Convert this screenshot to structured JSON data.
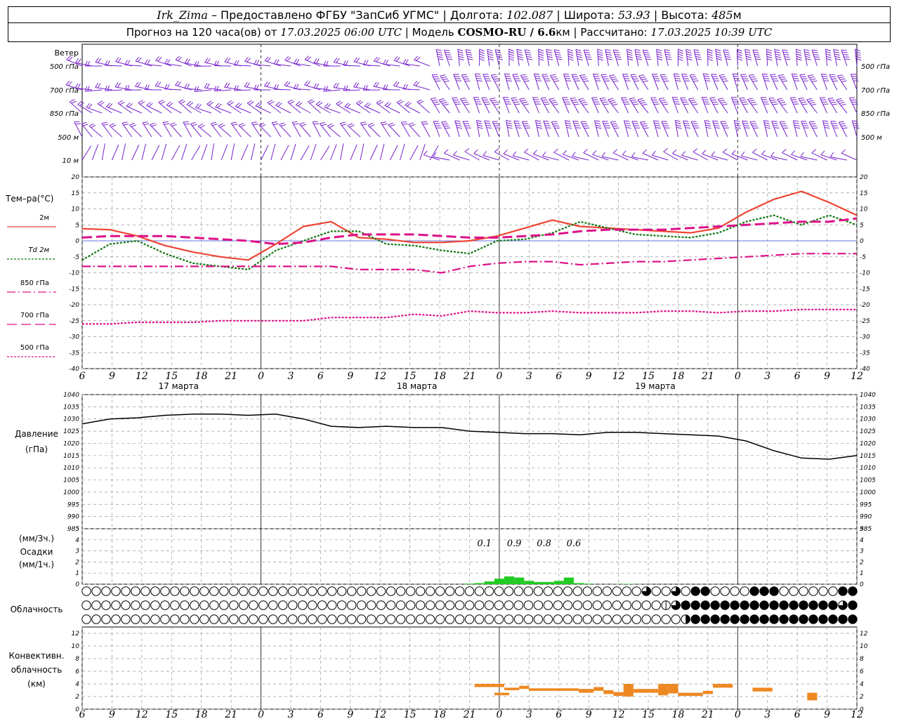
{
  "header": {
    "station": "Irk_Zima",
    "dash": " – Предоставлено ФГБУ \"ЗапСиб УГМС\" | Долгота: ",
    "lon": "102.087",
    "lat_label": " | Широта: ",
    "lat": "53.93",
    "alt_label": " | Высота: ",
    "alt": "485",
    "alt_unit": "м",
    "forecast_label": "Прогноз на 120 часа(ов) от ",
    "forecast_from": "17.03.2025 06:00 UTC",
    "model_label": " | Модель ",
    "model": "COSMO-RU / 6.6",
    "model_unit": "км",
    "calc_label": " | Рассчитано: ",
    "calc": "17.03.2025 10:39 UTC"
  },
  "colors": {
    "t2m": "#ee4433",
    "td2m": "#117711",
    "t850": "#dd1188",
    "t700": "#dd1188",
    "t500": "#dd1188",
    "wind": "#7722cc",
    "precip": "#22cc22",
    "conv": "#ee8822",
    "pressure": "#000000",
    "grid": "#999999"
  },
  "labels": {
    "wind": "Ветер",
    "wind_levels": [
      "500 гПа",
      "700 гПа",
      "850 гПа",
      "500 м",
      "10  м"
    ],
    "temp": "Тем–ра(°C)",
    "legend": [
      "2м",
      "Td  2м",
      "850 гПа",
      "700 гПа",
      "500 гПа"
    ],
    "pressure": [
      "Давление",
      "(гПа)"
    ],
    "precip": [
      "(мм/3ч.)",
      "Осадки",
      "(мм/1ч.)"
    ],
    "cloud": "Облачность",
    "conv": [
      "Конвективн.",
      "облачность",
      "(км)"
    ],
    "dates": [
      "17 марта",
      "18 марта",
      "19 марта"
    ],
    "precip_sums": [
      "0.1",
      "0.9",
      "0.8",
      "0.6"
    ]
  },
  "chart_data": [
    {
      "type": "line",
      "title": "Тем–ра(°C)",
      "x_hours": [
        0,
        3,
        6,
        9,
        12,
        15,
        18,
        21,
        24,
        27,
        30,
        33,
        36,
        39,
        42,
        45,
        48,
        51,
        54,
        57,
        60,
        63,
        66,
        69,
        72,
        75,
        78
      ],
      "x_tick_labels": [
        "6",
        "9",
        "12",
        "15",
        "18",
        "21",
        "0",
        "3",
        "6",
        "9",
        "12",
        "15",
        "18",
        "21",
        "0",
        "3",
        "6",
        "9",
        "12",
        "15",
        "18",
        "21",
        "0",
        "3",
        "6",
        "9",
        "12"
      ],
      "ylim": [
        -40,
        20
      ],
      "yticks": [
        20,
        15,
        10,
        5,
        0,
        -5,
        -10,
        -15,
        -20,
        -25,
        -30,
        -35,
        -40
      ],
      "series": [
        {
          "name": "2м",
          "values": [
            3.8,
            3.5,
            1.5,
            -1.5,
            -3.5,
            -5,
            -6,
            -1,
            4.5,
            6,
            1,
            0.5,
            -0.5,
            -0.5,
            0,
            1.5,
            4,
            6.5,
            4.5,
            4,
            3.5,
            3,
            2.5,
            4,
            9,
            13,
            15.5,
            12,
            8
          ]
        },
        {
          "name": "Td  2м",
          "values": [
            -6,
            -1,
            0,
            -4,
            -7,
            -8,
            -9,
            -3,
            0,
            3,
            3,
            -1,
            -1.5,
            -3,
            -4,
            0,
            0.5,
            2.5,
            6,
            4,
            2,
            1.5,
            1,
            2.5,
            6,
            8,
            5,
            8,
            5
          ]
        },
        {
          "name": "850 гПа",
          "values": [
            -8,
            -8,
            -8,
            -8,
            -8,
            -8,
            -8,
            -8,
            -8,
            -8,
            -9,
            -9,
            -9,
            -10,
            -8,
            -7,
            -6.5,
            -6.5,
            -7.5,
            -7,
            -6.5,
            -6.5,
            -6,
            -5.5,
            -5,
            -4.5,
            -4,
            -4,
            -4
          ]
        },
        {
          "name": "700 гПа",
          "values": [
            1,
            1.5,
            1.5,
            1.5,
            1,
            0.5,
            0,
            -1,
            -0.5,
            1,
            2,
            2,
            2,
            1.5,
            1,
            1,
            1.5,
            2,
            3,
            3.5,
            3.5,
            3.5,
            4,
            4.5,
            5,
            5.5,
            6,
            6,
            7
          ]
        },
        {
          "name": "500 гПа",
          "values": [
            -26,
            -26,
            -25.5,
            -25.5,
            -25.5,
            -25,
            -25,
            -25,
            -25,
            -24,
            -24,
            -24,
            -23,
            -23.5,
            -22,
            -22.5,
            -22.5,
            -22,
            -22.5,
            -22.5,
            -22.5,
            -22,
            -22,
            -22.5,
            -22,
            -22,
            -21.5,
            -21.5,
            -21.5
          ]
        }
      ]
    },
    {
      "type": "line",
      "title": "Давление",
      "ylabel": "(гПа)",
      "ylim": [
        985,
        1040
      ],
      "yticks": [
        1040,
        1035,
        1030,
        1025,
        1020,
        1015,
        1010,
        1005,
        1000,
        995,
        990,
        985
      ],
      "series": [
        {
          "name": "Давление",
          "values": [
            1028,
            1030,
            1030.5,
            1031.5,
            1032,
            1032,
            1031.5,
            1032,
            1030,
            1027,
            1026.5,
            1027,
            1026.5,
            1026.5,
            1025,
            1024.5,
            1024,
            1024,
            1023.5,
            1024.5,
            1024.5,
            1024,
            1023.5,
            1023,
            1021,
            1017,
            1014,
            1013.5,
            1015
          ]
        }
      ]
    },
    {
      "type": "bar",
      "title": "Осадки",
      "ylabel": "(мм/1ч.)",
      "ylim": [
        0,
        5
      ],
      "yticks": [
        5,
        4,
        3,
        2,
        1,
        0
      ],
      "categories_hours": [
        39,
        40,
        41,
        42,
        43,
        44,
        45,
        46,
        47,
        48,
        49,
        50,
        51,
        52,
        53,
        54,
        55,
        56
      ],
      "values": [
        0.05,
        0.1,
        0.25,
        0.5,
        0.7,
        0.6,
        0.3,
        0.2,
        0.2,
        0.3,
        0.6,
        0.1,
        0.05,
        0,
        0,
        0.02,
        0.03,
        0.01
      ],
      "sums_3h": [
        "0.1",
        "0.9",
        "0.8",
        "0.6"
      ]
    },
    {
      "type": "bar",
      "title": "Конвективн. облачность",
      "ylabel": "(км)",
      "ylim": [
        0,
        13
      ],
      "yticks": [
        12,
        10,
        8,
        6,
        4,
        2,
        0
      ],
      "segments": [
        {
          "h0": 39.5,
          "h1": 42.5,
          "bottom": 3.5,
          "top": 4
        },
        {
          "h0": 41.5,
          "h1": 43,
          "bottom": 2.2,
          "top": 2.6
        },
        {
          "h0": 42.5,
          "h1": 44,
          "bottom": 3,
          "top": 3.4
        },
        {
          "h0": 44,
          "h1": 45,
          "bottom": 3.2,
          "top": 3.7
        },
        {
          "h0": 45,
          "h1": 50,
          "bottom": 2.9,
          "top": 3.3
        },
        {
          "h0": 50,
          "h1": 51.5,
          "bottom": 2.6,
          "top": 3.2
        },
        {
          "h0": 51.5,
          "h1": 52.5,
          "bottom": 2.9,
          "top": 3.5
        },
        {
          "h0": 52.5,
          "h1": 53.5,
          "bottom": 2.4,
          "top": 3
        },
        {
          "h0": 53.5,
          "h1": 54.5,
          "bottom": 2.1,
          "top": 2.7
        },
        {
          "h0": 54.5,
          "h1": 55.5,
          "bottom": 2,
          "top": 4
        },
        {
          "h0": 55.5,
          "h1": 58,
          "bottom": 2.6,
          "top": 3.2
        },
        {
          "h0": 58,
          "h1": 59,
          "bottom": 2.2,
          "top": 4
        },
        {
          "h0": 59,
          "h1": 60,
          "bottom": 2.5,
          "top": 4
        },
        {
          "h0": 60,
          "h1": 62.5,
          "bottom": 2.1,
          "top": 2.6
        },
        {
          "h0": 62.5,
          "h1": 63.5,
          "bottom": 2.4,
          "top": 2.9
        },
        {
          "h0": 63.5,
          "h1": 65.5,
          "bottom": 3.4,
          "top": 4
        },
        {
          "h0": 67.5,
          "h1": 69.5,
          "bottom": 2.8,
          "top": 3.4
        },
        {
          "h0": 73,
          "h1": 74,
          "bottom": 1.4,
          "top": 2.6
        }
      ]
    },
    {
      "type": "table",
      "title": "Облачность",
      "rows": [
        "000000000000000000000000000000000000000000000000000000000300304400004440000004441443011444444444441100400101000",
        "000000000000000000000000000000000000000000000000000000000001344444444444444443444344442444444444444444413401402",
        "000000000000000000000000000000000000000000000000000000000000024444444444444444441222000000000000000000000000000000"
      ]
    }
  ]
}
